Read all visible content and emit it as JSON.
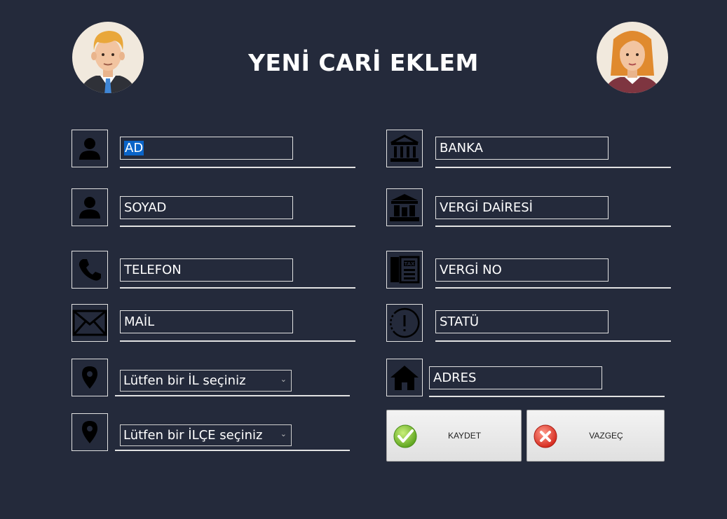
{
  "title": "YENİ CARİ EKLEM",
  "left_fields": [
    {
      "value": "AD",
      "icon": "person-icon"
    },
    {
      "value": "SOYAD",
      "icon": "person-icon"
    },
    {
      "value": "TELEFON",
      "icon": "phone-icon"
    },
    {
      "value": "MAİL",
      "icon": "mail-icon"
    }
  ],
  "right_fields": [
    {
      "value": "BANKA",
      "icon": "bank-icon"
    },
    {
      "value": "VERGİ DAİRESİ",
      "icon": "tax-office-icon"
    },
    {
      "value": "VERGİ NO",
      "icon": "tax-number-icon"
    },
    {
      "value": "STATÜ",
      "icon": "status-icon"
    },
    {
      "value": "ADRES",
      "icon": "home-icon"
    }
  ],
  "combos": {
    "il": "Lütfen bir İL seçiniz",
    "ilce": "Lütfen bir İLÇE seçiniz"
  },
  "buttons": {
    "save": "KAYDET",
    "cancel": "VAZGEÇ"
  },
  "colors": {
    "background": "#242a3b",
    "selection": "#0a64c8"
  }
}
